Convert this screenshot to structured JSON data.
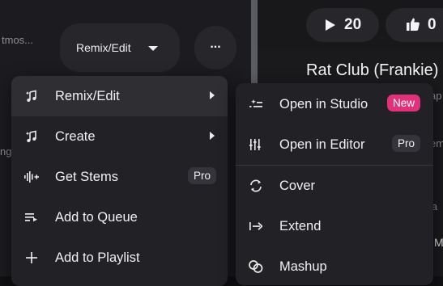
{
  "background": {
    "left_snippet_top": "tmos...",
    "left_snippet_mid": "ng",
    "right_snippets": [
      "ap",
      "em",
      "ja",
      "M"
    ]
  },
  "player": {
    "play_count": "20",
    "like_count": "0",
    "title": "Rat Club (Frankie)"
  },
  "toolbar": {
    "remix_label": "Remix/Edit",
    "more_label": "..."
  },
  "menu": {
    "items": [
      {
        "label": "Remix/Edit",
        "icon": "music-note-sparkle-icon",
        "submenu": true
      },
      {
        "label": "Create",
        "icon": "music-note-sparkle-icon",
        "submenu": true
      },
      {
        "label": "Get Stems",
        "icon": "waveform-plus-icon",
        "badge": "Pro"
      },
      {
        "label": "Add to Queue",
        "icon": "queue-icon"
      },
      {
        "label": "Add to Playlist",
        "icon": "plus-icon"
      }
    ]
  },
  "submenu": {
    "items": [
      {
        "label": "Open in Studio",
        "icon": "studio-icon",
        "badge": "New"
      },
      {
        "label": "Open in Editor",
        "icon": "sliders-icon",
        "badge": "Pro"
      },
      {
        "label": "Cover",
        "icon": "cover-icon"
      },
      {
        "label": "Extend",
        "icon": "extend-icon"
      },
      {
        "label": "Mashup",
        "icon": "mashup-icon"
      }
    ]
  },
  "colors": {
    "accent_new_badge": "#e0317a",
    "menu_bg": "#222226",
    "menu_hover_bg": "#2e2e33"
  }
}
